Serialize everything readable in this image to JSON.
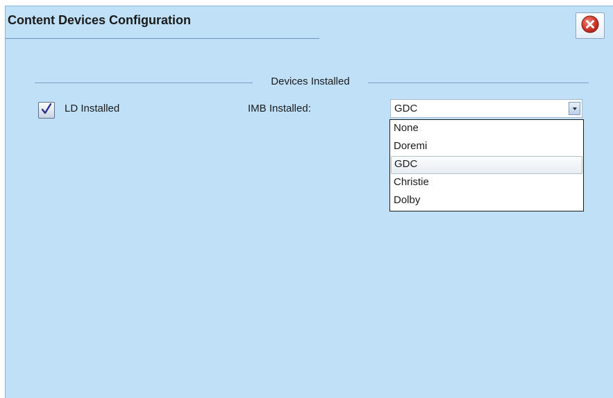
{
  "dialog": {
    "title": "Content Devices Configuration",
    "close_icon": "close-x-circle-icon",
    "accent_color": "#bfe0f6"
  },
  "devices_group": {
    "label": "Devices Installed"
  },
  "ld": {
    "label": "LD Installed",
    "checked": true,
    "check_icon": "checkmark-icon"
  },
  "imb": {
    "label": "IMB Installed:",
    "selected": "GDC",
    "arrow_icon": "chevron-down-icon",
    "options": [
      "None",
      "Doremi",
      "GDC",
      "Christie",
      "Dolby"
    ]
  }
}
